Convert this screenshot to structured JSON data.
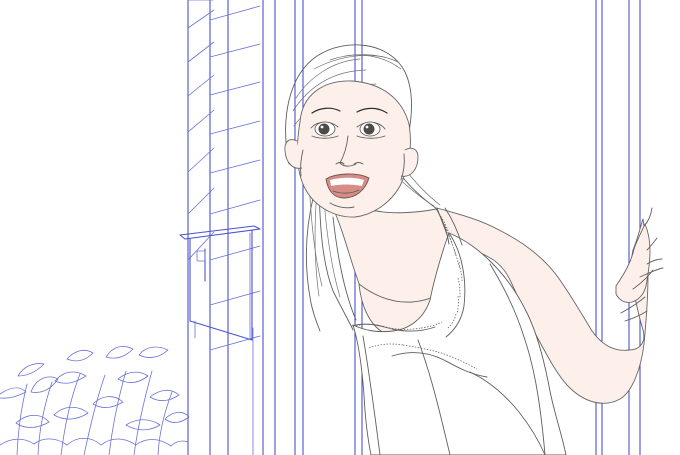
{
  "image": {
    "kind": "line-art illustration",
    "palette": {
      "background": "#ffffff",
      "door_lines": "#4a54cf",
      "ink": "#5f5f5f",
      "skin_tone": "#fdf0ea",
      "lips": "#d88c86"
    }
  }
}
